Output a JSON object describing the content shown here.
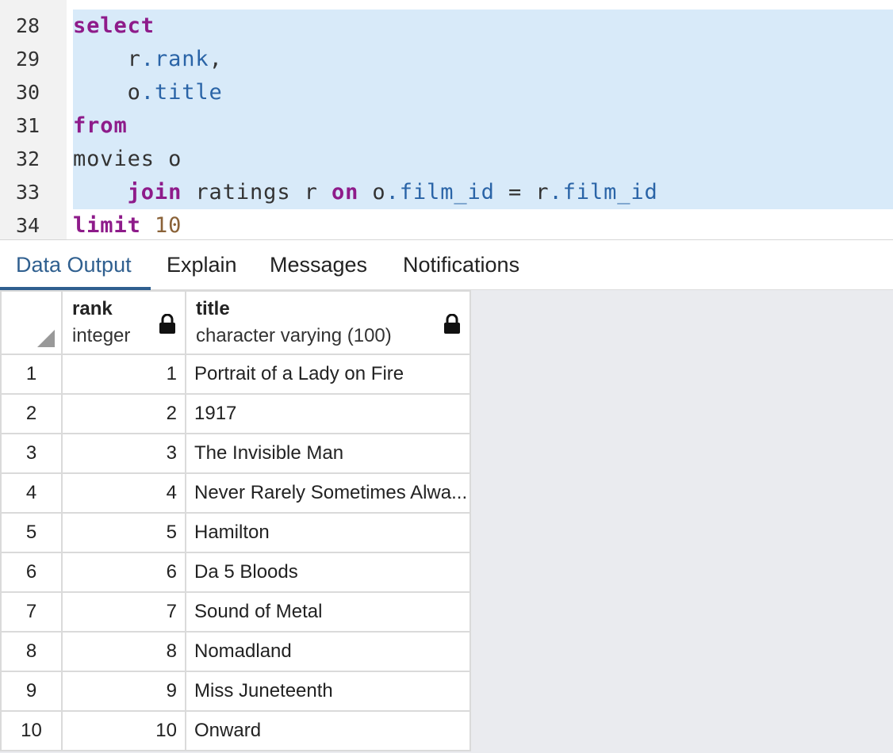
{
  "editor": {
    "lines": [
      {
        "num": "28"
      },
      {
        "num": "29"
      },
      {
        "num": "30"
      },
      {
        "num": "31"
      },
      {
        "num": "32"
      },
      {
        "num": "33"
      },
      {
        "num": "34"
      }
    ],
    "tokens": {
      "select": "select",
      "r1": "r",
      "dot1": ".",
      "rank": "rank",
      "comma": ",",
      "o1": "o",
      "dot2": ".",
      "title": "title",
      "from": "from",
      "movies": "movies o",
      "join": "join",
      "ratings": " ratings r ",
      "on": "on",
      "o2": " o",
      "dot3": ".",
      "film_id1": "film_id",
      "eq": " = r",
      "dot4": ".",
      "film_id2": "film_id",
      "limit": "limit",
      "ten": "10"
    }
  },
  "tabs": [
    {
      "label": "Data Output",
      "active": true
    },
    {
      "label": "Explain",
      "active": false
    },
    {
      "label": "Messages",
      "active": false
    },
    {
      "label": "Notifications",
      "active": false
    }
  ],
  "grid": {
    "columns": [
      {
        "name": "rank",
        "type": "integer"
      },
      {
        "name": "title",
        "type": "character varying (100)"
      }
    ],
    "rows": [
      {
        "n": "1",
        "rank": "1",
        "title": "Portrait of a Lady on Fire"
      },
      {
        "n": "2",
        "rank": "2",
        "title": "1917"
      },
      {
        "n": "3",
        "rank": "3",
        "title": "The Invisible Man"
      },
      {
        "n": "4",
        "rank": "4",
        "title": "Never Rarely Sometimes Alwa..."
      },
      {
        "n": "5",
        "rank": "5",
        "title": "Hamilton"
      },
      {
        "n": "6",
        "rank": "6",
        "title": "Da 5 Bloods"
      },
      {
        "n": "7",
        "rank": "7",
        "title": "Sound of Metal"
      },
      {
        "n": "8",
        "rank": "8",
        "title": "Nomadland"
      },
      {
        "n": "9",
        "rank": "9",
        "title": "Miss Juneteenth"
      },
      {
        "n": "10",
        "rank": "10",
        "title": "Onward"
      }
    ]
  },
  "colors": {
    "keyword": "#8e1b8a",
    "property": "#2a64a7",
    "number": "#8a6238",
    "selection": "#d8eaf9",
    "active_tab": "#2f5f8f"
  }
}
